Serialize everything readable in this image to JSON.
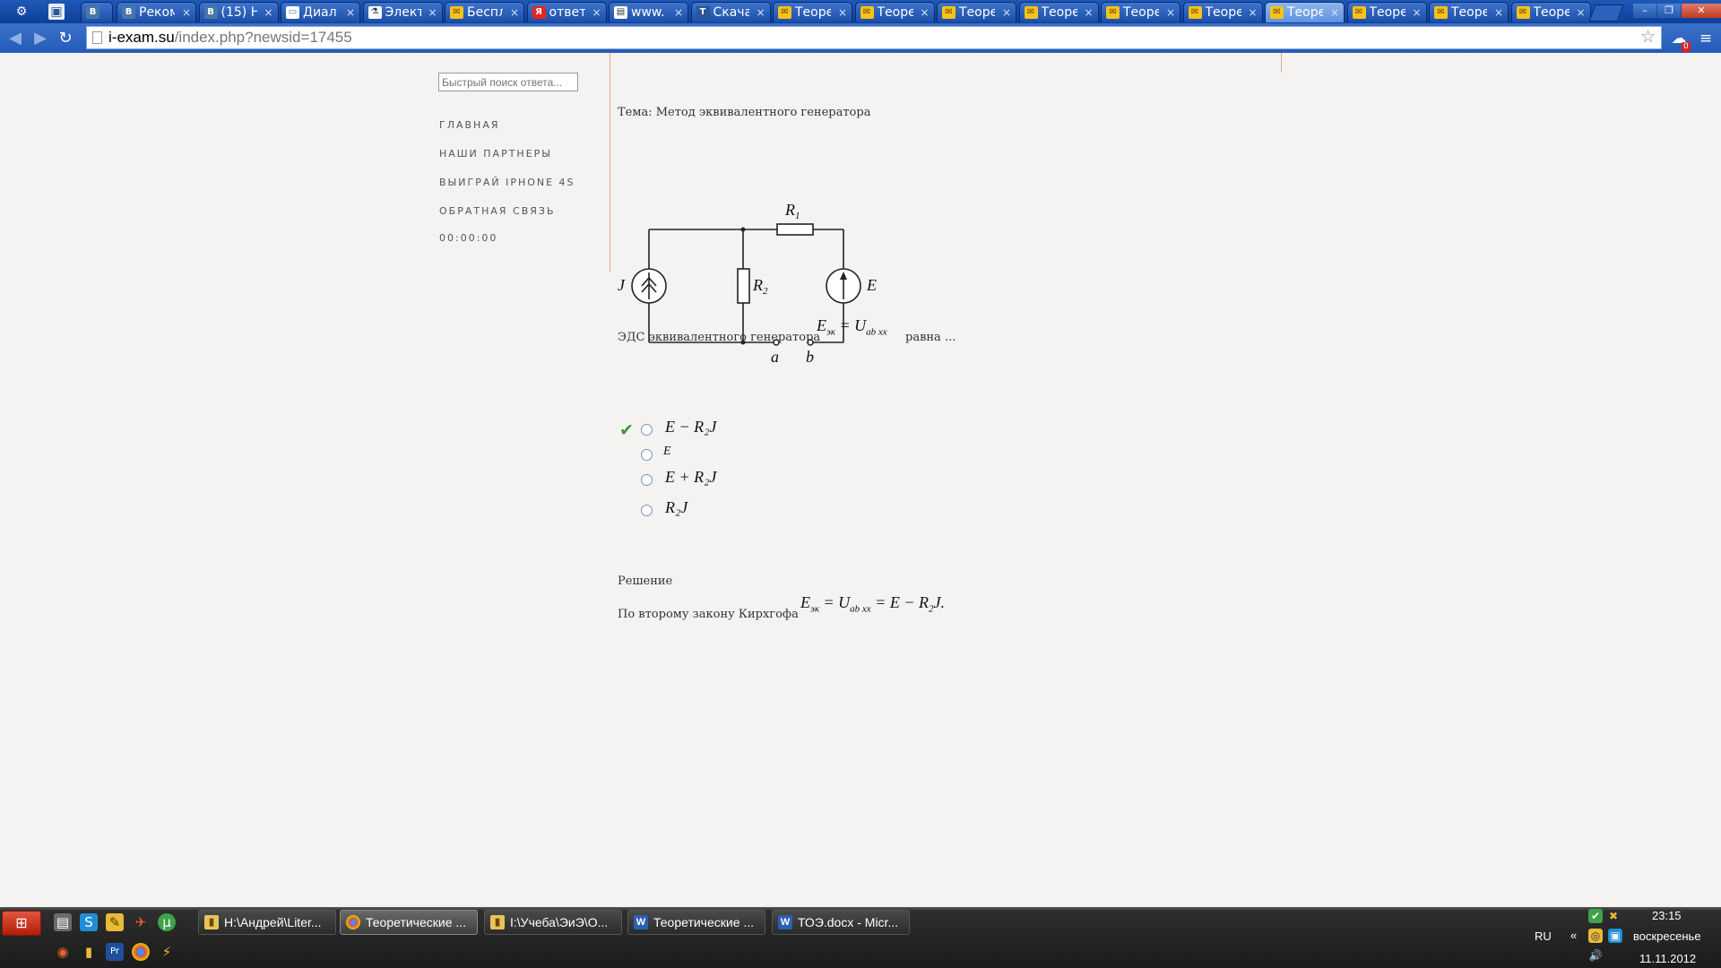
{
  "browser": {
    "tabs": [
      {
        "label": "",
        "favicon": "vk"
      },
      {
        "label": "Реком",
        "favicon": "vk"
      },
      {
        "label": "(15) Н",
        "favicon": "vk"
      },
      {
        "label": "Диал",
        "favicon": "chat"
      },
      {
        "label": "Элект",
        "favicon": "flask"
      },
      {
        "label": "Беспл",
        "favicon": "mail"
      },
      {
        "label": "ответ",
        "favicon": "yandex"
      },
      {
        "label": "www.",
        "favicon": "doc"
      },
      {
        "label": "Скача",
        "favicon": "t"
      },
      {
        "label": "Теоре",
        "favicon": "mail"
      },
      {
        "label": "Теоре",
        "favicon": "mail"
      },
      {
        "label": "Теоре",
        "favicon": "mail"
      },
      {
        "label": "Теоре",
        "favicon": "mail"
      },
      {
        "label": "Теоре",
        "favicon": "mail"
      },
      {
        "label": "Теоре",
        "favicon": "mail"
      },
      {
        "label": "Теоре",
        "favicon": "mail",
        "active": true
      },
      {
        "label": "Теоре",
        "favicon": "mail"
      },
      {
        "label": "Теоре",
        "favicon": "mail"
      },
      {
        "label": "Теоре",
        "favicon": "mail"
      }
    ],
    "url_domain": "i-exam.su",
    "url_path": "/index.php?newsid=17455",
    "extension_badge": "0"
  },
  "sidebar": {
    "search_placeholder": "Быстрый поиск ответа...",
    "links": [
      "Главная",
      "Наши партнеры",
      "Выиграй iPhone 4S",
      "Обратная связь"
    ],
    "timer": "00:00:00"
  },
  "main": {
    "topic": "Тема: Метод эквивалентного генератора",
    "question_prefix": "ЭДС эквивалентного генератора",
    "question_suffix": "равна ...",
    "circuit": {
      "labels": {
        "J": "J",
        "R1": "R",
        "R1_sub": "1",
        "R2": "R",
        "R2_sub": "2",
        "E": "E",
        "a": "a",
        "b": "b"
      }
    },
    "answers": [
      {
        "text": "E − R₂J",
        "correct": true
      },
      {
        "text": "E",
        "correct": false
      },
      {
        "text": "E + R₂J",
        "correct": false
      },
      {
        "text": "R₂J",
        "correct": false
      }
    ],
    "solution_heading": "Решение",
    "solution_text": "По второму закону Кирхгофа"
  },
  "taskbar": {
    "tasks": [
      {
        "label": "H:\\Андрей\\Liter...",
        "icon": "folder"
      },
      {
        "label": "Теоретические ...",
        "icon": "chrome",
        "active": true
      },
      {
        "label": "I:\\Учеба\\ЭиЭ\\О...",
        "icon": "folder"
      },
      {
        "label": "Теоретические ...",
        "icon": "word"
      },
      {
        "label": "ТОЭ.docx - Micr...",
        "icon": "word"
      }
    ],
    "language": "RU",
    "time": "23:15",
    "day": "воскресенье",
    "date": "11.11.2012"
  }
}
